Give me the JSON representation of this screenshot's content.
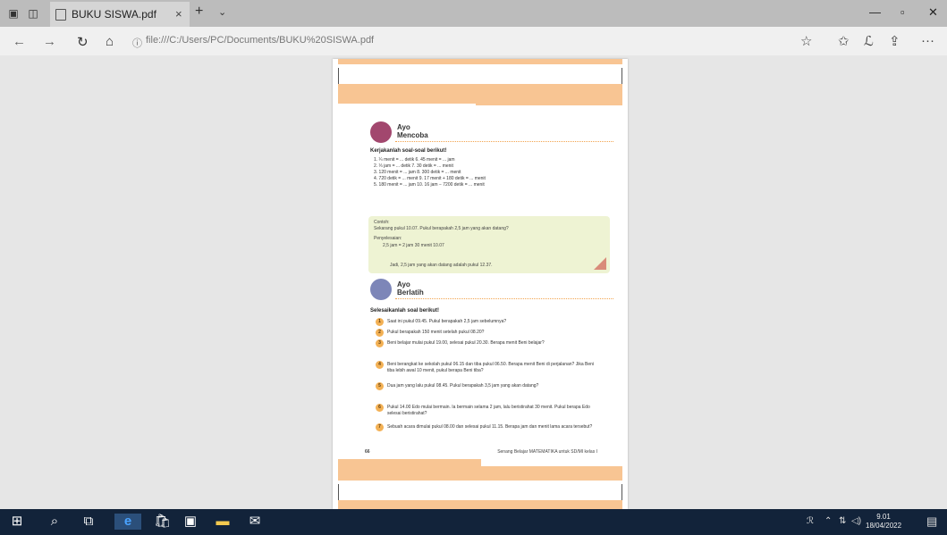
{
  "titlebar": {
    "tab_title": "BUKU SISWA.pdf",
    "tab_close": "×",
    "new_tab": "+",
    "tab_menu": "⌄",
    "minimize": "—",
    "maximize": "▫",
    "close": "✕"
  },
  "toolbar": {
    "back": "←",
    "forward": "→",
    "refresh": "↻",
    "home": "⌂",
    "url": "file:///C:/Users/PC/Documents/BUKU%20SISWA.pdf",
    "favorite": "☆",
    "favorites_bar": "✩",
    "sign": "ℒ",
    "share": "⇪",
    "more": "···"
  },
  "pdf": {
    "section1_title": "Ayo\nMencoba",
    "task1": "Kerjakanlah soal-soal berikut!",
    "conversions": [
      "1.  ¼ menit    = ... detik           6.  45 menit          = ... jam",
      "2.  ⅓ jam       = ... detik           7.  30 detik           = ... menit",
      "3.  120 menit  = ... jam              8.  300 detik          = ... menit",
      "4.  720 detik   = ... menit           9.  17 menit + 180 detik  = ... menit",
      "5.  180 menit  = ... jam             10. 16 jam − 7200 detik  = ... menit"
    ],
    "example_label": "Contoh:",
    "example_question": "Sekarang pukul 10.07. Pukul berapakah 2,5 jam yang akan datang?",
    "example_solution_label": "Penyelesaian:",
    "example_step": "2,5 jam = 2 jam 30 menit          10.07",
    "example_answer": "Jadi, 2,5 jam yang akan datang adalah pukul 12.37.",
    "section2_title": "Ayo\nBerlatih",
    "task2": "Selesaikanlah soal berikut!",
    "questions": [
      {
        "num": "1",
        "text": "Saat ini pukul 09.45. Pukul berapakah 2,5 jam sebelumnya?"
      },
      {
        "num": "2",
        "text": "Pukul berapakah 150 menit setelah pukul 08.20?"
      },
      {
        "num": "3",
        "text": "Beni belajar mulai pukul 19.00, selesai pukul 20.30. Berapa menit Beni belajar?"
      },
      {
        "num": "4",
        "text": "Beni berangkat ke sekolah pukul 06.15 dan tiba pukul 06.50. Berapa menit Beni di perjalanan? Jika Beni tiba lebih awal 10 menit, pukul berapa Beni tiba?"
      },
      {
        "num": "5",
        "text": "Dua jam yang lalu pukul 08.45. Pukul berapakah 3,5 jam yang akan datang?"
      },
      {
        "num": "6",
        "text": "Pukul 14.00 Edo mulai bermain. Ia bermain selama 2 jam, lalu beristirahat 30 menit. Pukul berapa Edo selesai beristirahat?"
      },
      {
        "num": "7",
        "text": "Sebuah acara dimulai pukul 08.00 dan selesai pukul 11.15. Berapa jam dan menit lama acara tersebut?"
      }
    ],
    "page_number": "66",
    "footer_text": "Senang Belajar MATEMATIKA untuk SD/MI kelas I"
  },
  "taskbar": {
    "start": "⊞",
    "search": "⌕",
    "taskview": "⧉",
    "edge": "e",
    "store": "🛍",
    "app1": "▣",
    "explorer": "▬",
    "mail": "✉",
    "people": "ℛ",
    "tray_up": "⌃",
    "network": "⇅",
    "volume": "◁)",
    "time": "9.01",
    "date": "18/04/2022",
    "notifications": "▤"
  }
}
